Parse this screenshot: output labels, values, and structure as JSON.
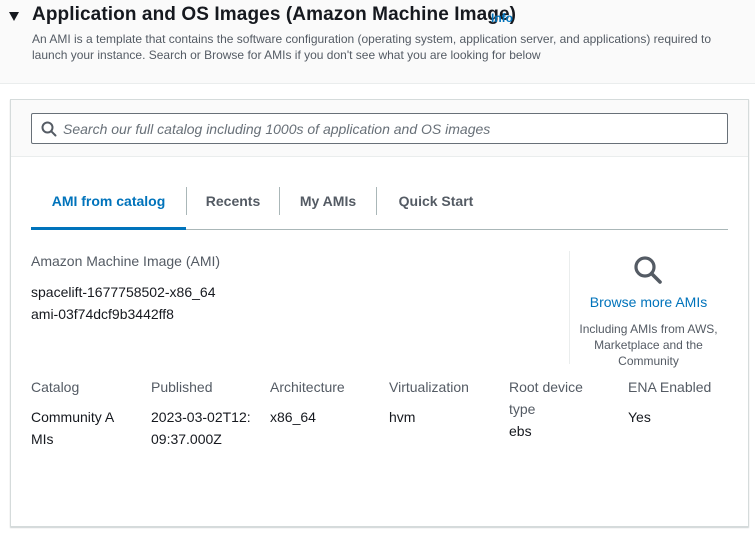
{
  "header": {
    "title": "Application and OS Images (Amazon Machine Image)",
    "info": "Info",
    "description": "An AMI is a template that contains the software configuration (operating system, application server, and applications) required to launch your instance. Search or Browse for AMIs if you don't see what you are looking for below"
  },
  "search": {
    "placeholder": "Search our full catalog including 1000s of application and OS images",
    "value": ""
  },
  "tabs": [
    {
      "label": "AMI from catalog",
      "active": true
    },
    {
      "label": "Recents",
      "active": false
    },
    {
      "label": "My AMIs",
      "active": false
    },
    {
      "label": "Quick Start",
      "active": false
    }
  ],
  "ami": {
    "section_label": "Amazon Machine Image (AMI)",
    "name": "spacelift-1677758502-x86_64",
    "id": "ami-03f74dcf9b3442ff8"
  },
  "browse": {
    "link": "Browse more AMIs",
    "description": "Including AMIs from AWS, Marketplace and the Community",
    "icon": "search-icon"
  },
  "details": [
    {
      "label": "Catalog",
      "value": "Community AMIs"
    },
    {
      "label": "Published",
      "value": "2023-03-02T12:09:37.000Z"
    },
    {
      "label": "Architecture",
      "value": "x86_64"
    },
    {
      "label": "Virtualization",
      "value": "hvm"
    },
    {
      "label": "Root device type",
      "value": "ebs"
    },
    {
      "label": "ENA Enabled",
      "value": "Yes"
    }
  ],
  "colors": {
    "link": "#0073bb",
    "text": "#16191f",
    "muted": "#545b64"
  }
}
